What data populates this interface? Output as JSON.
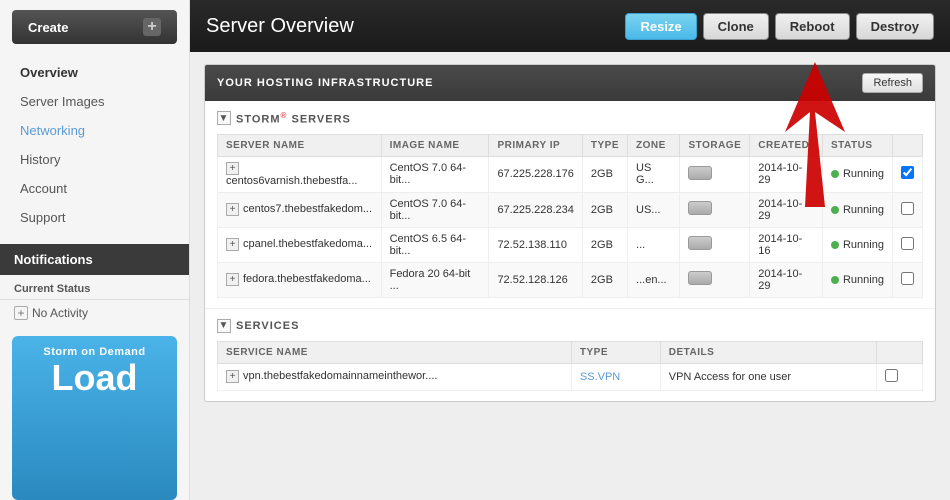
{
  "sidebar": {
    "create_label": "Create",
    "nav_items": [
      {
        "label": "Overview",
        "class": "active",
        "name": "overview"
      },
      {
        "label": "Server Images",
        "class": "",
        "name": "server-images"
      },
      {
        "label": "Networking",
        "class": "networking",
        "name": "networking"
      },
      {
        "label": "History",
        "class": "history",
        "name": "history"
      },
      {
        "label": "Account",
        "class": "",
        "name": "account"
      },
      {
        "label": "Support",
        "class": "",
        "name": "support"
      }
    ],
    "notifications_label": "Notifications",
    "current_status_label": "Current Status",
    "no_activity_label": "No Activity",
    "storm_banner_top": "Storm on Demand",
    "storm_banner_load": "Load"
  },
  "header": {
    "title": "Server Overview",
    "buttons": [
      {
        "label": "Resize",
        "active": true,
        "name": "resize-button"
      },
      {
        "label": "Clone",
        "active": false,
        "name": "clone-button"
      },
      {
        "label": "Reboot",
        "active": false,
        "name": "reboot-button"
      },
      {
        "label": "Destroy",
        "active": false,
        "name": "destroy-button"
      }
    ]
  },
  "infra": {
    "title": "YOUR HOSTING INFRASTRUCTURE",
    "refresh_label": "Refresh",
    "storm_servers": {
      "section_title": "STORM",
      "section_suffix": " SERVERS",
      "columns": [
        "SERVER NAME",
        "IMAGE NAME",
        "PRIMARY IP",
        "TYPE",
        "ZONE",
        "STORAGE",
        "CREATED",
        "STATUS",
        ""
      ],
      "rows": [
        {
          "name": "centos6varnish.thebestfa...",
          "image": "CentOS 7.0 64-bit...",
          "ip": "67.225.228.176",
          "type": "2GB",
          "zone": "US G...",
          "storage": "",
          "created": "2014-10-29",
          "status": "Running",
          "checked": true
        },
        {
          "name": "centos7.thebestfakedom...",
          "image": "CentOS 7.0 64-bit...",
          "ip": "67.225.228.234",
          "type": "2GB",
          "zone": "US...",
          "storage": "",
          "created": "2014-10-29",
          "status": "Running",
          "checked": false
        },
        {
          "name": "cpanel.thebestfakedoma...",
          "image": "CentOS 6.5 64-bit...",
          "ip": "72.52.138.110",
          "type": "2GB",
          "zone": "...",
          "storage": "",
          "created": "2014-10-16",
          "status": "Running",
          "checked": false
        },
        {
          "name": "fedora.thebestfakedoma...",
          "image": "Fedora 20 64-bit ...",
          "ip": "72.52.128.126",
          "type": "2GB",
          "zone": "...en...",
          "storage": "",
          "created": "2014-10-29",
          "status": "Running",
          "checked": false
        }
      ]
    },
    "services": {
      "section_title": "SERVICES",
      "columns": [
        "SERVICE NAME",
        "TYPE",
        "DETAILS",
        ""
      ],
      "rows": [
        {
          "name": "vpn.thebestfakedomainnameinthewor....",
          "type": "SS.VPN",
          "details": "VPN Access for one user",
          "checked": false
        }
      ]
    }
  }
}
